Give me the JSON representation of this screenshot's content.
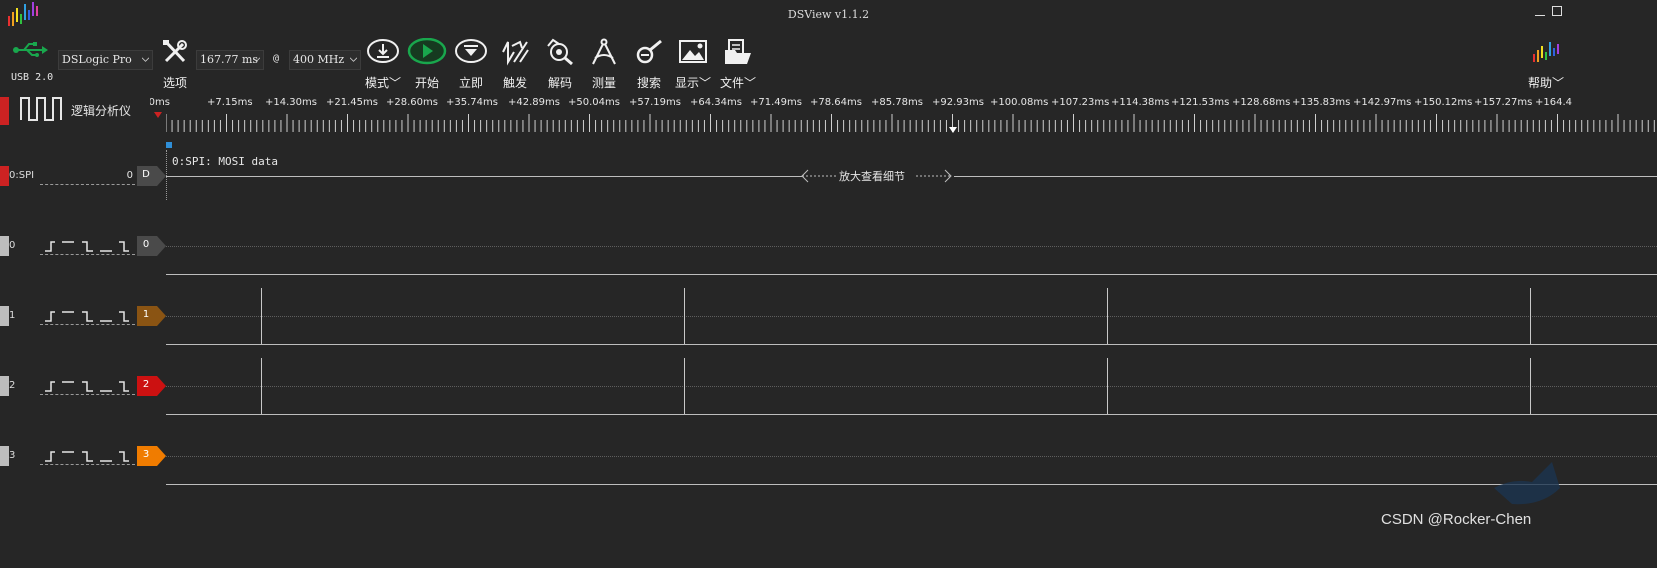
{
  "window": {
    "title": "DSView v1.1.2"
  },
  "device": {
    "usb_label": "USB 2.0",
    "selected": "DSLogic Pro",
    "duration": "167.77 ms",
    "at_sign": "@",
    "sample_rate": "400 MHz"
  },
  "toolbar": {
    "options": "选项",
    "mode": "模式",
    "start": "开始",
    "instant": "立即",
    "trigger": "触发",
    "decode": "解码",
    "measure": "测量",
    "search": "搜索",
    "display": "显示",
    "file": "文件",
    "help": "帮助"
  },
  "mode_panel": {
    "label": "逻辑分析仪"
  },
  "ruler": {
    "labels": [
      "0ms",
      "+7.15ms",
      "+14.30ms",
      "+21.45ms",
      "+28.60ms",
      "+35.74ms",
      "+42.89ms",
      "+50.04ms",
      "+57.19ms",
      "+64.34ms",
      "+71.49ms",
      "+78.64ms",
      "+85.78ms",
      "+92.93ms",
      "+100.08ms",
      "+107.23ms",
      "+114.38ms",
      "+121.53ms",
      "+128.68ms",
      "+135.83ms",
      "+142.97ms",
      "+150.12ms",
      "+157.27ms",
      "+164.4"
    ]
  },
  "decoder": {
    "channel_name": "0:SPI",
    "channel_index": "0",
    "badge": "D",
    "row_label": "0:SPI: MOSI data",
    "zoom_hint": "放大查看细节"
  },
  "channels": [
    {
      "name": "0",
      "badge": "0",
      "color": "#4a4a4a"
    },
    {
      "name": "1",
      "badge": "1",
      "color": "#8a5413"
    },
    {
      "name": "2",
      "badge": "2",
      "color": "#cc1111"
    },
    {
      "name": "3",
      "badge": "3",
      "color": "#f07c00"
    }
  ],
  "colors": {
    "background": "#262626",
    "decoder_marker": "#cc2222",
    "start_green": "#19a74d"
  },
  "watermark": "CSDN @Rocker-Chen"
}
